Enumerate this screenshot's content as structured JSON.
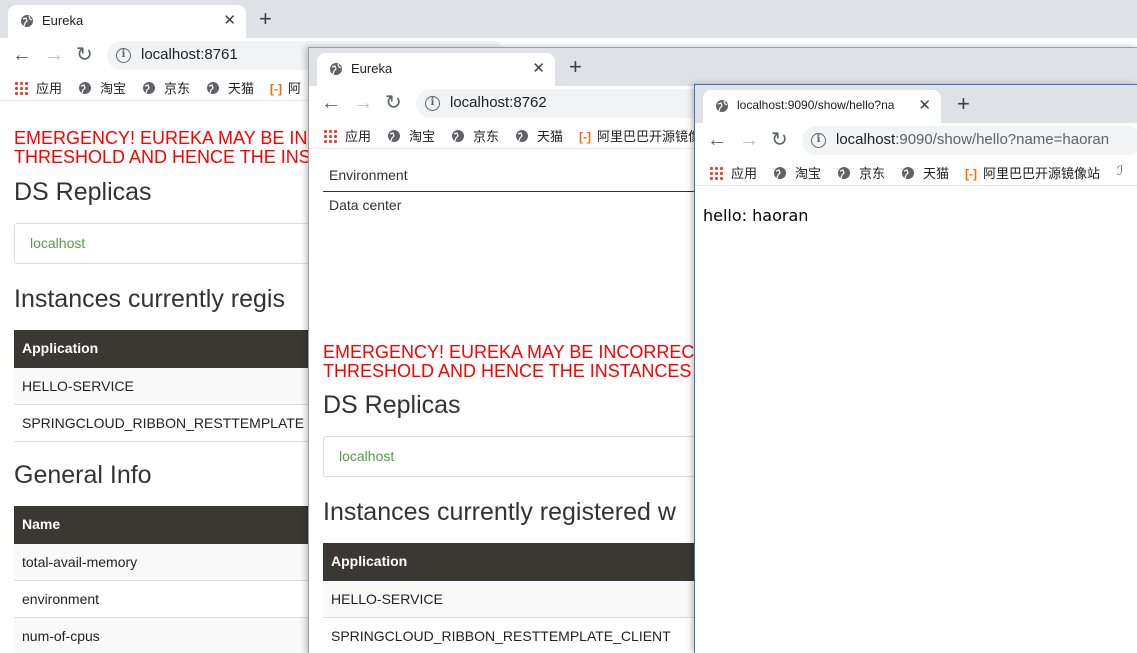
{
  "window1": {
    "tab_title": "Eureka",
    "url": "localhost:8761",
    "bookmarks": [
      "应用",
      "淘宝",
      "京东",
      "天猫",
      "阿"
    ],
    "emergency_line1": "EMERGENCY! EUREKA MAY BE IN",
    "emergency_line2": "THRESHOLD AND HENCE THE INS",
    "ds_replicas_heading": "DS Replicas",
    "replica": "localhost",
    "instances_heading": "Instances currently regis",
    "instances_table": {
      "header": "Application",
      "rows": [
        "HELLO-SERVICE",
        "SPRINGCLOUD_RIBBON_RESTTEMPLATE"
      ]
    },
    "general_info_heading": "General Info",
    "general_table": {
      "header": "Name",
      "rows": [
        "total-avail-memory",
        "environment",
        "num-of-cpus"
      ]
    }
  },
  "window2": {
    "tab_title": "Eureka",
    "url": "localhost:8762",
    "bookmarks": [
      "应用",
      "淘宝",
      "京东",
      "天猫",
      "阿里巴巴开源镜像"
    ],
    "environment_label": "Environment",
    "datacenter_label": "Data center",
    "emergency_line1": "EMERGENCY! EUREKA MAY BE INCORREC",
    "emergency_line2": "THRESHOLD AND HENCE THE INSTANCES",
    "ds_replicas_heading": "DS Replicas",
    "replica": "localhost",
    "instances_heading": "Instances currently registered w",
    "instances_table": {
      "header": "Application",
      "rows": [
        "HELLO-SERVICE",
        "SPRINGCLOUD_RIBBON_RESTTEMPLATE_CLIENT"
      ]
    }
  },
  "window3": {
    "tab_title": "localhost:9090/show/hello?na",
    "url_host": "localhost",
    "url_path": ":9090/show/hello?name=haoran",
    "bookmarks": [
      "应用",
      "淘宝",
      "京东",
      "天猫",
      "阿里巴巴开源镜像站"
    ],
    "body_text": "hello:  haoran"
  },
  "colors": {
    "emergency": "#ff0000",
    "table_header": "#3b3834",
    "replica_link": "#5a9a4a"
  }
}
